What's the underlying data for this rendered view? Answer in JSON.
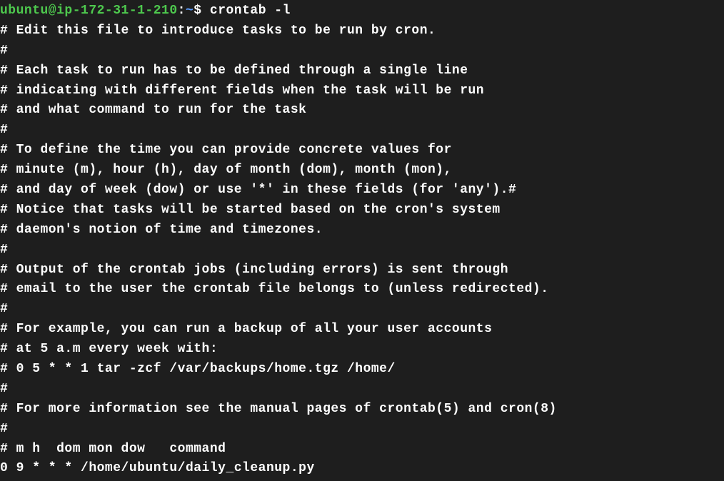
{
  "prompt": {
    "user_host": "ubuntu@ip-172-31-1-210",
    "colon": ":",
    "path": "~",
    "dollar": "$"
  },
  "command": "crontab -l",
  "output": [
    "# Edit this file to introduce tasks to be run by cron.",
    "#",
    "# Each task to run has to be defined through a single line",
    "# indicating with different fields when the task will be run",
    "# and what command to run for the task",
    "#",
    "# To define the time you can provide concrete values for",
    "# minute (m), hour (h), day of month (dom), month (mon),",
    "# and day of week (dow) or use '*' in these fields (for 'any').#",
    "# Notice that tasks will be started based on the cron's system",
    "# daemon's notion of time and timezones.",
    "#",
    "# Output of the crontab jobs (including errors) is sent through",
    "# email to the user the crontab file belongs to (unless redirected).",
    "#",
    "# For example, you can run a backup of all your user accounts",
    "# at 5 a.m every week with:",
    "# 0 5 * * 1 tar -zcf /var/backups/home.tgz /home/",
    "#",
    "# For more information see the manual pages of crontab(5) and cron(8)",
    "#",
    "# m h  dom mon dow   command",
    "0 9 * * * /home/ubuntu/daily_cleanup.py"
  ]
}
